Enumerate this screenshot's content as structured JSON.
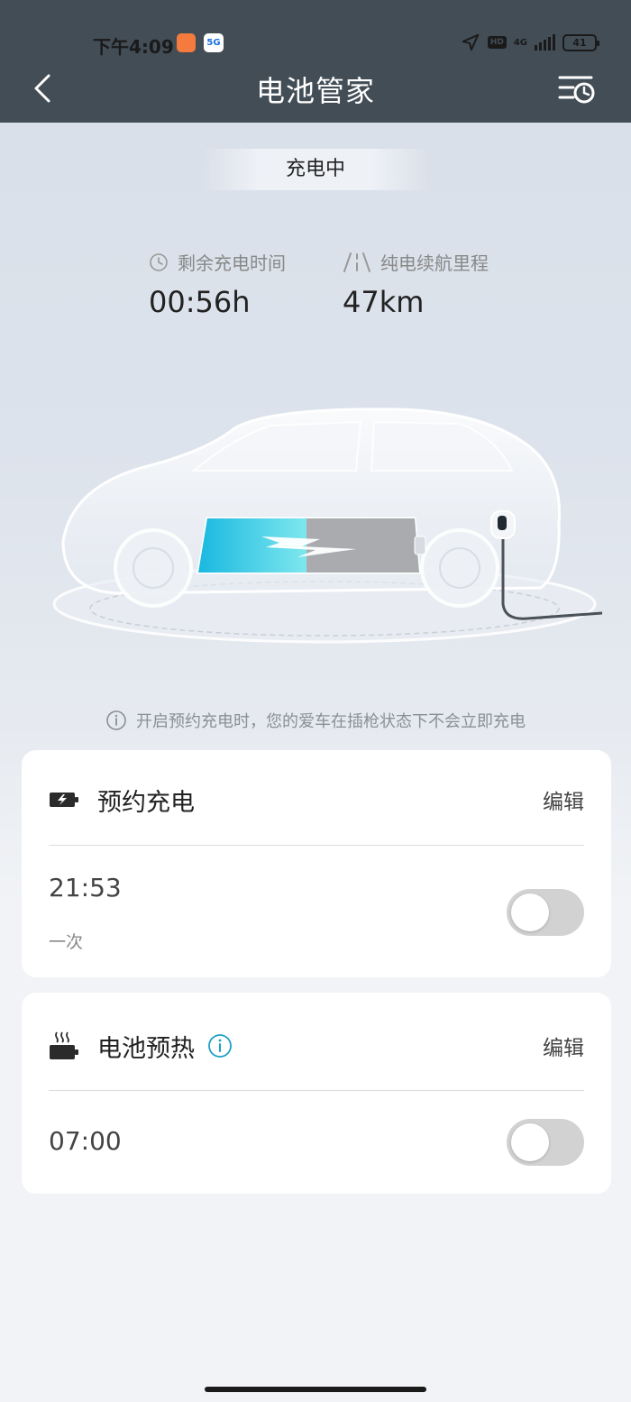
{
  "status_bar": {
    "time": "下午4:09",
    "network_badge": "5G",
    "hd_badge": "HD",
    "network_type": "4G",
    "battery_level": "41"
  },
  "header": {
    "title": "电池管家"
  },
  "charging": {
    "status_label": "充电中",
    "remaining_time_label": "剩余充电时间",
    "remaining_time_value": "00:56h",
    "range_label": "纯电续航里程",
    "range_value": "47km"
  },
  "notice": {
    "text": "开启预约充电时，您的爱车在插枪状态下不会立即充电"
  },
  "scheduled_charging": {
    "title": "预约充电",
    "edit_label": "编辑",
    "time": "21:53",
    "frequency": "一次",
    "enabled": false
  },
  "battery_preheat": {
    "title": "电池预热",
    "edit_label": "编辑",
    "time": "07:00",
    "enabled": false
  },
  "colors": {
    "header_bg": "#434d56",
    "accent_teal": "#1f9fc4",
    "battery_fill": "#3ec9e6",
    "toggle_off": "#d2d2d2"
  }
}
